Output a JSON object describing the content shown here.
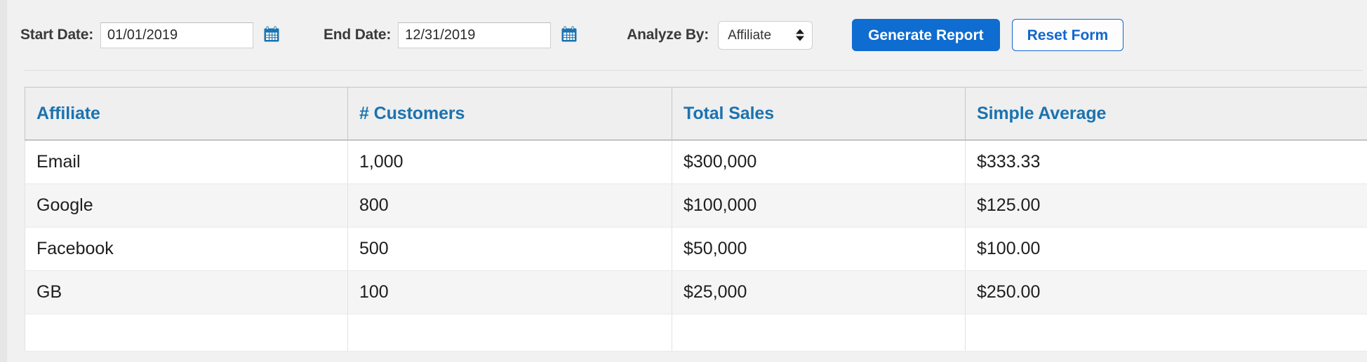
{
  "filters": {
    "start_date": {
      "label": "Start Date:",
      "value": "01/01/2019",
      "placeholder": "mm/dd/yyyy",
      "calendar_icon": "calendar-icon"
    },
    "end_date": {
      "label": "End Date:",
      "value": "12/31/2019",
      "placeholder": "mm/dd/yyyy",
      "calendar_icon": "calendar-icon"
    },
    "analyze_by": {
      "label": "Analyze By:",
      "value": "Affiliate",
      "options": [
        "Affiliate"
      ]
    },
    "generate_button": "Generate Report",
    "reset_button": "Reset Form"
  },
  "colors": {
    "primary_button": "#0f6cd0",
    "secondary_button_text": "#1266cc",
    "table_header_text": "#1b73b0",
    "calendar_icon": "#1b73b0",
    "page_background": "#f1f1f1",
    "row_alt_background": "#f5f5f5"
  },
  "table": {
    "columns": [
      "Affiliate",
      "# Customers",
      "Total Sales",
      "Simple Average"
    ],
    "rows": [
      [
        "Email",
        "1,000",
        "$300,000",
        "$333.33"
      ],
      [
        "Google",
        "800",
        "$100,000",
        "$125.00"
      ],
      [
        "Facebook",
        "500",
        "$50,000",
        "$100.00"
      ],
      [
        "GB",
        "100",
        "$25,000",
        "$250.00"
      ],
      [
        "",
        "",
        "",
        ""
      ]
    ]
  }
}
